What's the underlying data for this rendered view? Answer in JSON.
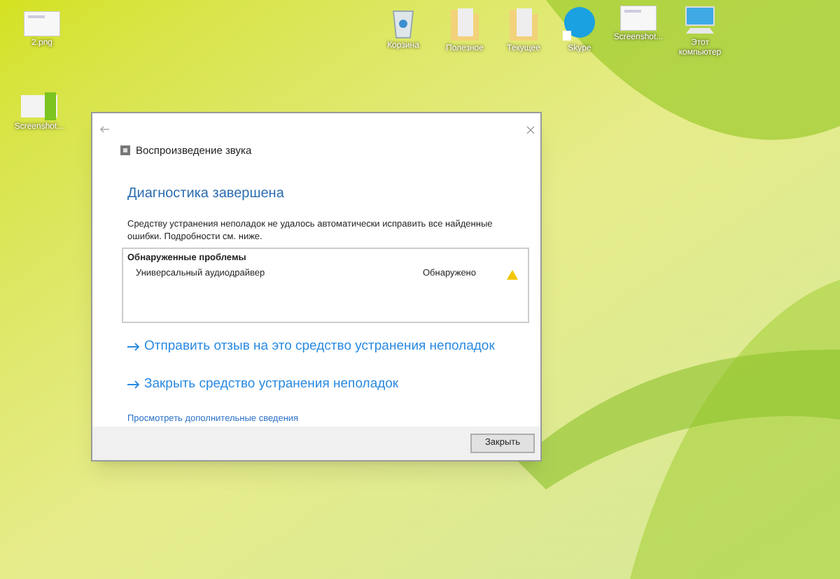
{
  "desktop_icons": [
    {
      "label": "2.png",
      "kind": "image"
    },
    {
      "label": "Screenshot...",
      "kind": "screenshot"
    },
    {
      "label": "Корзина",
      "kind": "recycle"
    },
    {
      "label": "Полезное",
      "kind": "folder"
    },
    {
      "label": "Текущее",
      "kind": "folder"
    },
    {
      "label": "Skype",
      "kind": "skype"
    },
    {
      "label": "Screenshot...",
      "kind": "image"
    },
    {
      "label": "Этот компьютер",
      "kind": "computer"
    }
  ],
  "window": {
    "title": "Воспроизведение звука",
    "heading": "Диагностика завершена",
    "message": "Средству устранения неполадок не удалось автоматически исправить все найденные ошибки. Подробности см. ниже.",
    "problems": {
      "header": "Обнаруженные проблемы",
      "rows": [
        {
          "name": "Универсальный аудиодрайвер",
          "status": "Обнаружено"
        }
      ]
    },
    "actions": [
      "Отправить отзыв на это средство устранения неполадок",
      "Закрыть средство устранения неполадок"
    ],
    "details_link": "Просмотреть дополнительные сведения",
    "buttons": [
      "Закрыть"
    ]
  }
}
